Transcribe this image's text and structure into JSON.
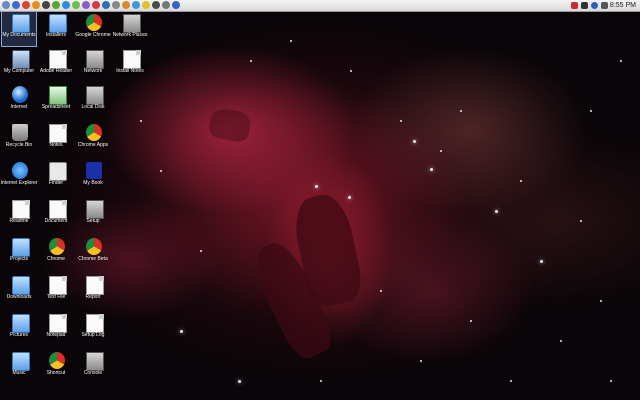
{
  "menubar": {
    "clock": "8:55 PM",
    "tray_icons": [
      "app-icon",
      "app-icon",
      "app-icon",
      "app-icon",
      "app-icon",
      "app-icon",
      "app-icon",
      "app-icon",
      "app-icon",
      "app-icon",
      "app-icon",
      "app-icon",
      "app-icon",
      "app-icon",
      "app-icon",
      "app-icon",
      "app-icon",
      "app-icon"
    ],
    "colors": {
      "bar_top": "#f4f4f4",
      "bar_bottom": "#d9d9d9"
    }
  },
  "desktop": {
    "wallpaper": "nebula",
    "icons": [
      {
        "name": "icon-r1c1",
        "type": "folder",
        "label": "My Documents"
      },
      {
        "name": "icon-r1c2",
        "type": "folder",
        "label": "Installers"
      },
      {
        "name": "icon-r1c3",
        "type": "chrome",
        "label": "Google Chrome"
      },
      {
        "name": "icon-r1c4",
        "type": "server",
        "label": "Network Places"
      },
      {
        "name": "icon-r2c1",
        "type": "monitor",
        "label": "My Computer"
      },
      {
        "name": "icon-r2c2",
        "type": "doc",
        "label": "Adobe Reader"
      },
      {
        "name": "icon-r2c3",
        "type": "server",
        "label": "Network"
      },
      {
        "name": "icon-r2c4",
        "type": "doc",
        "label": "Install Notes"
      },
      {
        "name": "icon-r3c1",
        "type": "globe",
        "label": "Internet"
      },
      {
        "name": "icon-r3c2",
        "type": "sheet",
        "label": "Spreadsheet"
      },
      {
        "name": "icon-r3c3",
        "type": "server",
        "label": "Local Disk"
      },
      {
        "name": "icon-r4c1",
        "type": "bin",
        "label": "Recycle Bin"
      },
      {
        "name": "icon-r4c2",
        "type": "doc",
        "label": "Notes"
      },
      {
        "name": "icon-r4c3",
        "type": "chrome",
        "label": "Chrome Apps"
      },
      {
        "name": "icon-r5c1",
        "type": "ie",
        "label": "Internet Explorer"
      },
      {
        "name": "icon-r5c2",
        "type": "mac",
        "label": "Finder"
      },
      {
        "name": "icon-r5c3",
        "type": "wd",
        "label": "My Book"
      },
      {
        "name": "icon-r6c1",
        "type": "doc",
        "label": "Readme"
      },
      {
        "name": "icon-r6c2",
        "type": "doc",
        "label": "Document"
      },
      {
        "name": "icon-r6c3",
        "type": "server",
        "label": "Setup"
      },
      {
        "name": "icon-r7c1",
        "type": "folder",
        "label": "Projects"
      },
      {
        "name": "icon-r7c2",
        "type": "chrome",
        "label": "Chrome"
      },
      {
        "name": "icon-r7c3",
        "type": "chrome",
        "label": "Chrome Beta"
      },
      {
        "name": "icon-r8c1",
        "type": "folder",
        "label": "Downloads"
      },
      {
        "name": "icon-r8c2",
        "type": "doc",
        "label": "Text File"
      },
      {
        "name": "icon-r8c3",
        "type": "doc",
        "label": "Report"
      },
      {
        "name": "icon-r9c1",
        "type": "folder",
        "label": "Pictures"
      },
      {
        "name": "icon-r9c2",
        "type": "doc",
        "label": "Notepad"
      },
      {
        "name": "icon-r9c3",
        "type": "doc",
        "label": "Setup Log"
      },
      {
        "name": "icon-r10c1",
        "type": "folder",
        "label": "Music"
      },
      {
        "name": "icon-r10c2",
        "type": "chrome",
        "label": "Shortcut"
      },
      {
        "name": "icon-r10c3",
        "type": "server",
        "label": "Console"
      }
    ]
  }
}
